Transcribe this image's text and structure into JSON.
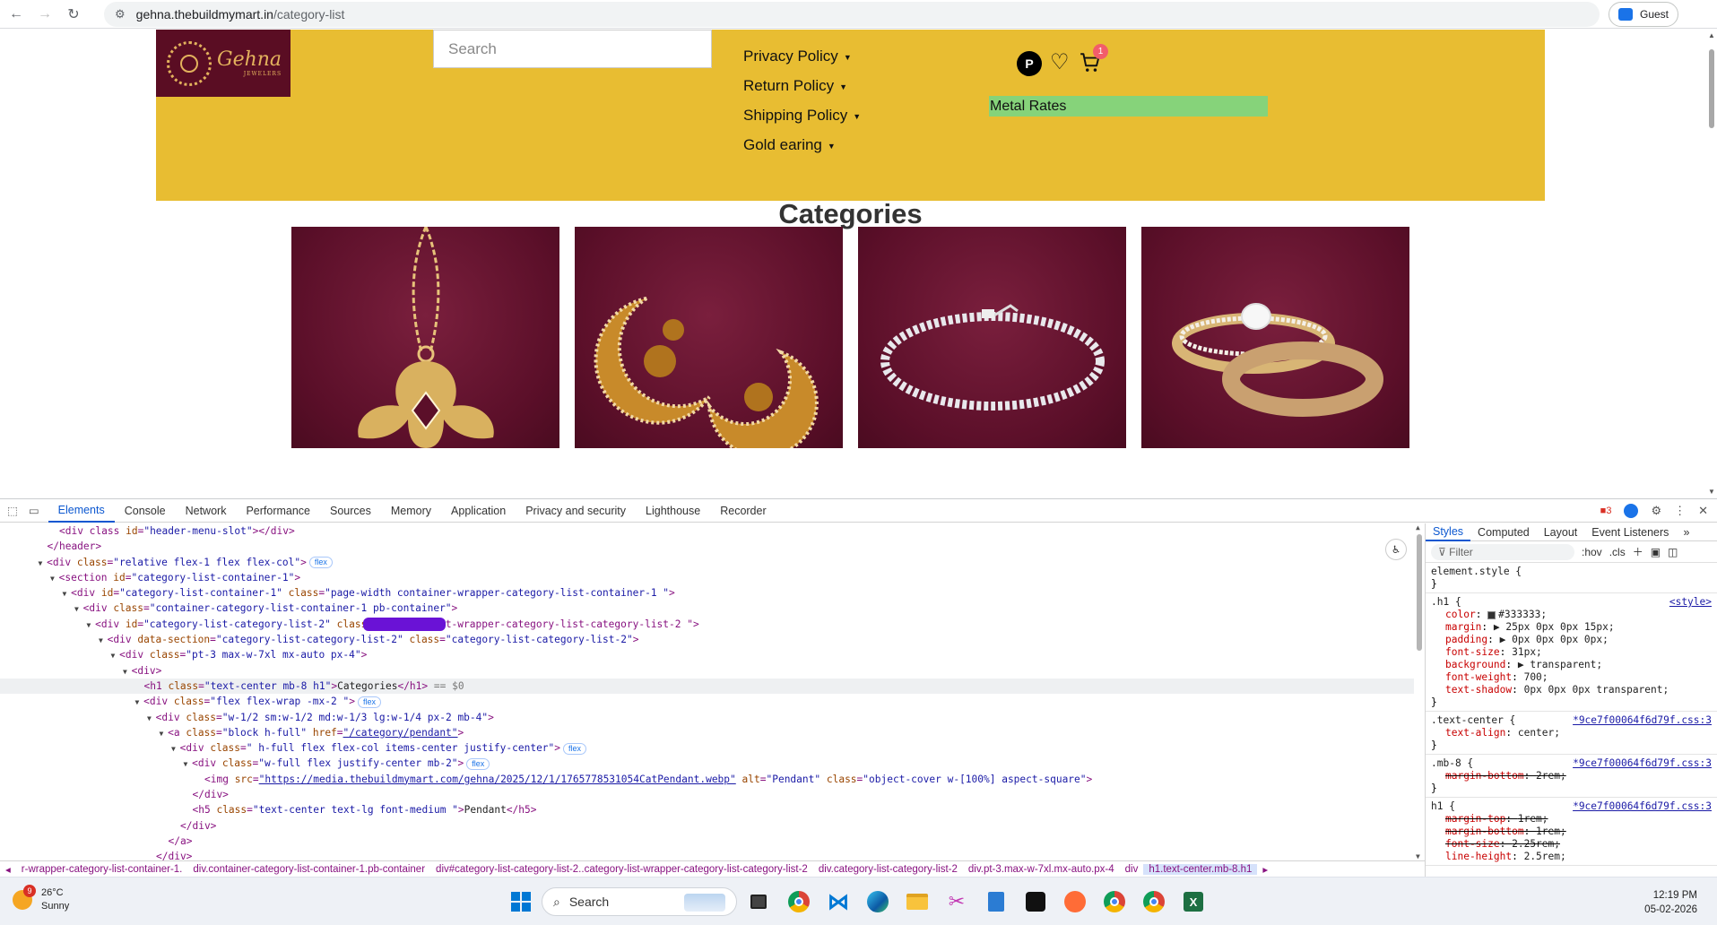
{
  "browser": {
    "url_host": "gehna.thebuildmymart.in",
    "url_path": "/category-list",
    "profile_label": "Guest"
  },
  "site": {
    "logo_text": "Gehna",
    "logo_subtext": "JEWELERS",
    "search_placeholder": "Search",
    "menu": [
      "Privacy Policy",
      "Return Policy",
      "Shipping Policy",
      "Gold earing"
    ],
    "profile_initial": "P",
    "cart_count": "1",
    "metal_rates_label": "Metal Rates",
    "page_heading": "Categories",
    "categories": [
      "Pendant",
      "Earrings",
      "Bracelet",
      "Rings"
    ],
    "colors": {
      "header_bg": "#e8bd32",
      "logo_bg": "#5a0d23",
      "metal_rates_bg": "#86d37a",
      "card_bg": "#5b0f29"
    }
  },
  "devtools": {
    "tabs": [
      "Elements",
      "Console",
      "Network",
      "Performance",
      "Sources",
      "Memory",
      "Application",
      "Privacy and security",
      "Lighthouse",
      "Recorder"
    ],
    "active_tab": "Elements",
    "error_count": "3",
    "dom_lines": [
      {
        "indent": 4,
        "tri": "",
        "html": "<div class id=\"header-menu-slot\"></div>"
      },
      {
        "indent": 3,
        "tri": "",
        "html": "</header>"
      },
      {
        "indent": 3,
        "tri": "▼",
        "html": "<div class=\"relative flex-1 flex flex-col\">",
        "flex": true
      },
      {
        "indent": 4,
        "tri": "▼",
        "html": "<section id=\"category-list-container-1\">"
      },
      {
        "indent": 5,
        "tri": "▼",
        "html": "<div id=\"category-list-container-1\" class=\"page-width container-wrapper-category-list-container-1 \">"
      },
      {
        "indent": 6,
        "tri": "▼",
        "html": "<div class=\"container-category-list-container-1  pb-container\">"
      },
      {
        "indent": 7,
        "tri": "▼",
        "html": "<div id=\"category-list-category-list-2\" class=\"",
        "redact": true,
        "after": "t-wrapper-category-list-category-list-2 \">"
      },
      {
        "indent": 8,
        "tri": "▼",
        "html": "<div data-section=\"category-list-category-list-2\" class=\"category-list-category-list-2\">"
      },
      {
        "indent": 9,
        "tri": "▼",
        "html": "<div class=\"pt-3 max-w-7xl mx-auto px-4\">"
      },
      {
        "indent": 10,
        "tri": "▼",
        "html": "<div>"
      },
      {
        "indent": 11,
        "tri": "",
        "html": "<h1 class=\"text-center  mb-8 h1\">Categories</h1>",
        "selected": true
      },
      {
        "indent": 11,
        "tri": "▼",
        "html": "<div class=\"flex flex-wrap -mx-2     \">",
        "flex": true
      },
      {
        "indent": 12,
        "tri": "▼",
        "html": "<div class=\"w-1/2 sm:w-1/2 md:w-1/3 lg:w-1/4 px-2 mb-4\">"
      },
      {
        "indent": 13,
        "tri": "▼",
        "html": "<a class=\"block h-full\" href=\"/category/pendant\">"
      },
      {
        "indent": 14,
        "tri": "▼",
        "html": "<div class=\"    h-full flex flex-col items-center justify-center\">",
        "flex": true
      },
      {
        "indent": 15,
        "tri": "▼",
        "html": "<div class=\"w-full flex justify-center mb-2\">",
        "flex": true
      },
      {
        "indent": 16,
        "tri": "",
        "html": "<img src=\"https://media.thebuildmymart.com/gehna/2025/12/1/1765778531054CatPendant.webp\" alt=\"Pendant\" class=\"object-cover  w-[100%]  aspect-square\">"
      },
      {
        "indent": 15,
        "tri": "",
        "html": "</div>"
      },
      {
        "indent": 15,
        "tri": "",
        "html": "<h5 class=\"text-center text-lg font-medium \">Pendant</h5>"
      },
      {
        "indent": 14,
        "tri": "",
        "html": "</div>"
      },
      {
        "indent": 13,
        "tri": "",
        "html": "</a>"
      },
      {
        "indent": 12,
        "tri": "",
        "html": "</div>"
      }
    ],
    "selected_suffix": "== $0",
    "flex_badge": "flex",
    "breadcrumbs": [
      "r-wrapper-category-list-container-1.",
      "div.container-category-list-container-1.pb-container",
      "div#category-list-category-list-2..category-list-wrapper-category-list-category-list-2",
      "div.category-list-category-list-2",
      "div.pt-3.max-w-7xl.mx-auto.px-4",
      "div",
      "h1.text-center.mb-8.h1"
    ],
    "styles_tabs": [
      "Styles",
      "Computed",
      "Layout",
      "Event Listeners"
    ],
    "styles_filter": "Filter",
    "styles_hov": ":hov",
    "styles_cls": ".cls",
    "rules": [
      {
        "selector": "element.style {",
        "source": "",
        "props": [],
        "close": "}"
      },
      {
        "selector": ".h1 {",
        "source": "<style>",
        "props": [
          {
            "n": "color",
            "v": "#333333;",
            "swatch": "#333333"
          },
          {
            "n": "margin",
            "v": "▶ 25px 0px 0px 15px;"
          },
          {
            "n": "padding",
            "v": "▶ 0px 0px 0px 0px;"
          },
          {
            "n": "font-size",
            "v": "31px;"
          },
          {
            "n": "background",
            "v": "▶ transparent;"
          },
          {
            "n": "font-weight",
            "v": "700;"
          },
          {
            "n": "text-shadow",
            "v": "0px 0px 0px transparent;"
          }
        ],
        "close": "}"
      },
      {
        "selector": ".text-center {",
        "source": "*9ce7f00064f6d79f.css:3",
        "props": [
          {
            "n": "text-align",
            "v": "center;"
          }
        ],
        "close": "}"
      },
      {
        "selector": ".mb-8 {",
        "source": "*9ce7f00064f6d79f.css:3",
        "props": [
          {
            "n": "margin-bottom",
            "v": "2rem;",
            "strike": true
          }
        ],
        "close": "}"
      },
      {
        "selector": "h1 {",
        "source": "*9ce7f00064f6d79f.css:3",
        "props": [
          {
            "n": "margin-top",
            "v": "1rem;",
            "strike": true
          },
          {
            "n": "margin-bottom",
            "v": "1rem;",
            "strike": true
          },
          {
            "n": "font-size",
            "v": "2.25rem;",
            "strike": true
          },
          {
            "n": "line-height",
            "v": "2.5rem;"
          }
        ],
        "close": ""
      }
    ]
  },
  "taskbar": {
    "temperature": "26°C",
    "weather": "Sunny",
    "weather_badge": "9",
    "search_label": "Search",
    "time": "12:19 PM",
    "date": "05-02-2026"
  }
}
